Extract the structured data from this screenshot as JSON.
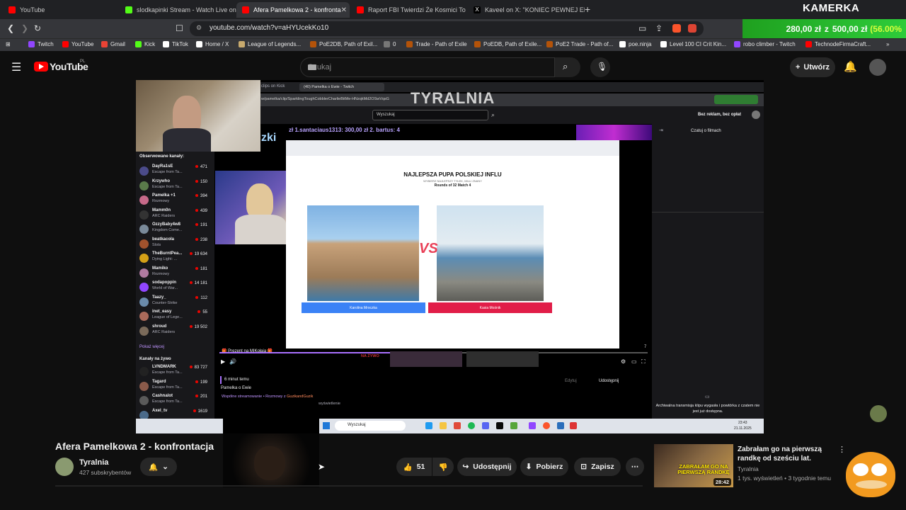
{
  "browser": {
    "tabs": [
      {
        "label": "YouTube",
        "color": "#ff0000"
      },
      {
        "label": "slodkapinki Stream - Watch Live on K",
        "color": "#53fc18"
      },
      {
        "label": "Afera Pamelkowa 2 - konfronta",
        "color": "#ff0000"
      },
      {
        "label": "Raport FBI Twierdzi Że Kosmici To Is",
        "color": "#ff0000"
      },
      {
        "label": "Kaveel on X: \"KONIEC PEWNEJ ERY. J",
        "color": "#ffffff"
      }
    ],
    "url": "youtube.com/watch?v=aHYUcekKo10",
    "bookmarks": [
      {
        "label": "Twitch",
        "color": "#9146ff"
      },
      {
        "label": "YouTube",
        "color": "#ff0000"
      },
      {
        "label": "Gmail",
        "color": "#ea4335"
      },
      {
        "label": "Kick",
        "color": "#53fc18"
      },
      {
        "label": "TikTok",
        "color": "#ffffff"
      },
      {
        "label": "Home / X",
        "color": "#ffffff"
      },
      {
        "label": "League of Legends...",
        "color": "#c8aa6e"
      },
      {
        "label": "PoE2DB, Path of Exil...",
        "color": "#b45309"
      },
      {
        "label": "0",
        "color": "#aaaaaa"
      },
      {
        "label": "Trade - Path of Exile",
        "color": "#b45309"
      },
      {
        "label": "PoEDB, Path of Exile...",
        "color": "#b45309"
      },
      {
        "label": "PoE2 Trade - Path of...",
        "color": "#b45309"
      },
      {
        "label": "poe.ninja",
        "color": "#ffffff"
      },
      {
        "label": "Level 100 CI Crit Kin...",
        "color": "#ffffff"
      },
      {
        "label": "robo climber - Twitch",
        "color": "#9146ff"
      },
      {
        "label": "TechnodeFirmaCraft...",
        "color": "#ff0000"
      }
    ]
  },
  "overlay": {
    "kamerka": "KAMERKA",
    "donation_current": "280,00 zł",
    "donation_sep": "z",
    "donation_goal": "500,00 zł",
    "donation_pct": "(56.00%"
  },
  "youtube": {
    "logo": "YouTube",
    "logo_region": "PL",
    "search_placeholder": "Szukaj",
    "create_label": "Utwórz",
    "video_title": "Afera Pamelkowa 2 - konfrontacja",
    "channel_name": "Tyralnia",
    "subscribers": "427 subskrybentów",
    "likes": "51",
    "share_label": "Udostępnij",
    "download_label": "Pobierz",
    "save_label": "Zapisz",
    "rec_title": "Zabrałam go na pierwszą randkę od sześciu lat.",
    "rec_channel": "Tyralnia",
    "rec_meta": "1 tys. wyświetleń • 3 tygodnie temu",
    "rec_duration": "28:42",
    "rec_thumb_text": "ZABRAŁAM GO NA PIERWSZĄ RANDKĘ"
  },
  "stream": {
    "watermark": "TYRALNIA",
    "twitch_search": "Wyszukaj",
    "inner_tab_1": "clips on Kick",
    "inner_tab_2": "(40) Pamelka o Ewie - Twitch",
    "inner_url": "w/pamelka/clip/SparklingToughCobblerCharlieBitMe-HNzqkMd2OSwVqsG",
    "sub_ticker": "zł 1.santaciaus1313: 300,00 zł 2. bartus: 4",
    "ad_free": "Bez reklam, bez opłat",
    "followed_header": "Obserwowane kanały:",
    "followed": [
      {
        "name": "DayRa1sE",
        "game": "Escape from Ta...",
        "viewers": "471",
        "color": "#4b4b8a"
      },
      {
        "name": "Krzywho",
        "game": "Escape from Ta...",
        "viewers": "150",
        "color": "#5a7a4a"
      },
      {
        "name": "Pamelka +1",
        "game": "Rozmowy",
        "viewers": "394",
        "color": "#c76a8a"
      },
      {
        "name": "Mamm0n",
        "game": "ARC Raiders",
        "viewers": "439",
        "color": "#333333"
      },
      {
        "name": "OzzyBaby4w8",
        "game": "Kingdom Come...",
        "viewers": "191",
        "color": "#7a8a9a"
      },
      {
        "name": "beatkacola",
        "game": "Slots",
        "viewers": "238",
        "color": "#a0522d"
      },
      {
        "name": "TheBurntPea...",
        "game": "Dying Light: ...",
        "viewers": "19 634",
        "color": "#d4a017"
      },
      {
        "name": "Mamiko",
        "game": "Rozmowy",
        "viewers": "181",
        "color": "#b07aa0"
      },
      {
        "name": "sodapoppin",
        "game": "World of War...",
        "viewers": "14 181",
        "color": "#9146ff"
      },
      {
        "name": "Taazy_",
        "game": "Counter-Strike",
        "viewers": "112",
        "color": "#6a8aaa"
      },
      {
        "name": "inet_easy",
        "game": "League of Lege...",
        "viewers": "55",
        "color": "#aa6a5a"
      },
      {
        "name": "shroud",
        "game": "ARC Raiders",
        "viewers": "19 502",
        "color": "#7a6a5a"
      }
    ],
    "show_more": "Pokaż więcej",
    "live_header": "Kanały na żywo",
    "live": [
      {
        "name": "LVNDMARK",
        "game": "Escape from Ta...",
        "viewers": "83 727",
        "color": "#222222"
      },
      {
        "name": "Tagard",
        "game": "Escape from Ta...",
        "viewers": "199",
        "color": "#8a5a4a"
      },
      {
        "name": "Cashnalot",
        "game": "Escape from Ta...",
        "viewers": "201",
        "color": "#5a5a5a"
      },
      {
        "name": "Axel_tv",
        "game": "",
        "viewers": "1619",
        "color": "#4a6a8a"
      }
    ],
    "chat_header": "Czatuj o filmach",
    "chat_archived": "Archiwalna transmisja klipu wygasła i powtórka z czatem nie jest już dostępna.",
    "game_title": "NAJLEPSZA PUPA POLSKIEJ INFLU",
    "game_sub1": "WYBIERZ NAJLEPSZY TYŁEK, MILLI ZNANY",
    "game_sub2": "Rounds of 32 Match 4",
    "vs": "VS",
    "choice_left": "Karolina Mroczka",
    "choice_right": "Kasia Mośnik",
    "gift_label": "🎁 Prezent na MIKołaja 🎁",
    "clip_time": "6 minut temu",
    "clip_title": "Pamelka o Ewie",
    "clip_tags": "Wspólne streamowanie • Rozmowy z",
    "clip_collab": "GuzikandGuzik",
    "clip_views": "wyświetlenie",
    "edit_label": "Edytuj",
    "share_label": "Udostępnij",
    "live_badge": "NA ŻYWO",
    "taskbar_search": "Wyszukaj",
    "clock_time": "23:43",
    "clock_date": "21.11.2025",
    "overlay_word": "zki",
    "page_num": "7"
  }
}
